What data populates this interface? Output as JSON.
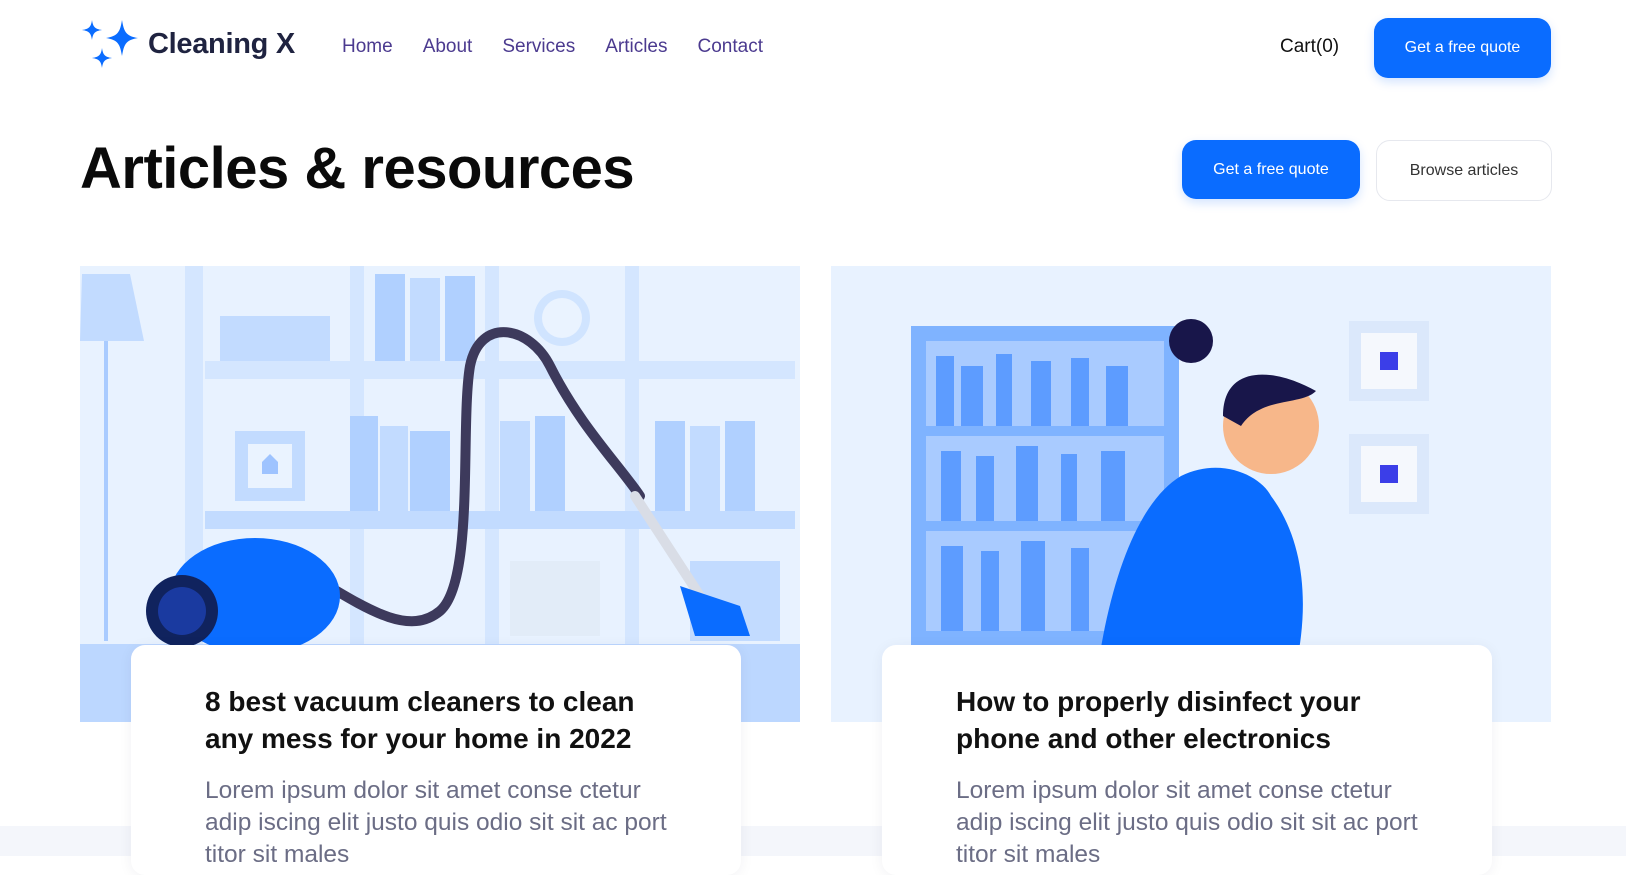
{
  "brand": {
    "name": "Cleaning X"
  },
  "nav": {
    "links": [
      "Home",
      "About",
      "Services",
      "Articles",
      "Contact"
    ],
    "cart_label": "Cart(0)",
    "cta_label": "Get a free quote"
  },
  "hero": {
    "title": "Articles & resources",
    "primary_button": "Get a free quote",
    "secondary_button": "Browse articles"
  },
  "articles": [
    {
      "title": "8 best vacuum cleaners to clean any mess for your home in 2022",
      "excerpt": "Lorem ipsum dolor sit amet conse ctetur adip iscing elit justo quis odio sit sit ac port titor sit males"
    },
    {
      "title": "How to properly disinfect your phone and other electronics",
      "excerpt": "Lorem ipsum dolor sit amet conse ctetur adip iscing elit justo quis odio sit sit ac port titor sit males"
    }
  ],
  "colors": {
    "accent": "#0a6cff",
    "nav_link": "#4b3a8f",
    "heading": "#0a0a0a",
    "body_text": "#6b6d85"
  },
  "icons": {
    "logo": "sparkles-icon"
  }
}
